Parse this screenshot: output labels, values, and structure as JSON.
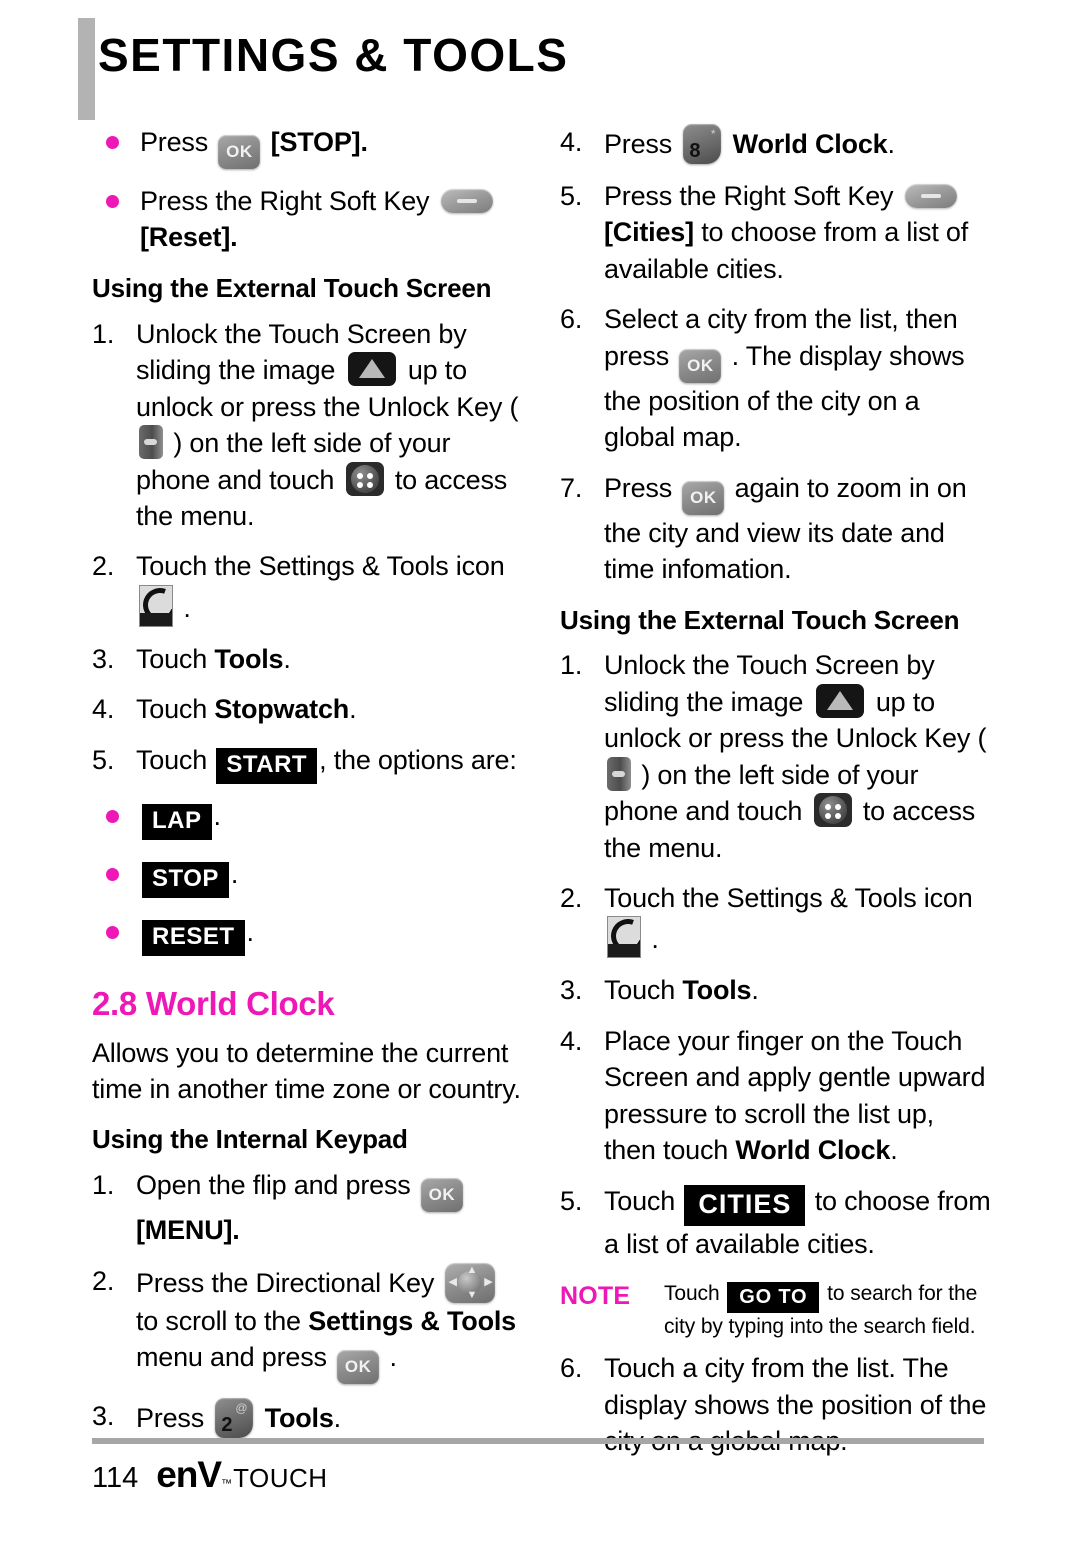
{
  "header": {
    "title": "SETTINGS & TOOLS"
  },
  "icons": {
    "ok_key": "OK",
    "num2_digit": "2",
    "num2_sup": "@",
    "num8_digit": "8",
    "num8_sup": "*"
  },
  "left_column": {
    "bullets_top": [
      {
        "pre": "Press ",
        "key": "ok-key",
        "post": " [STOP]."
      },
      {
        "pre": "Press the Right Soft Key ",
        "key": "right-soft-key",
        "post": " [Reset]."
      }
    ],
    "bullet1_text_pre": "Press",
    "bullet1_text_post": "[STOP].",
    "bullet2_text_pre": "Press the Right Soft Key",
    "bullet2_text_post": "[Reset].",
    "heading_external": "Using the External Touch Screen",
    "step1_a": "Unlock the Touch Screen by sliding the image",
    "step1_b": "up to unlock or press the Unlock Key (",
    "step1_c": ") on the left side of your phone and touch",
    "step1_d": "to access the menu.",
    "step2_a": "Touch the Settings & Tools icon",
    "step2_b": ".",
    "step3_a": "Touch ",
    "step3_b": "Tools",
    "step3_c": ".",
    "step4_a": "Touch ",
    "step4_b": "Stopwatch",
    "step4_c": ".",
    "step5_a": "Touch",
    "step5_btn": "START",
    "step5_b": ", the options are:",
    "options": [
      "LAP",
      "STOP",
      "RESET"
    ],
    "option_suffix": ".",
    "chapter_heading": "2.8 World Clock",
    "chapter_intro": "Allows you to determine the current time in another time zone or country.",
    "heading_internal": "Using the Internal Keypad",
    "k_step1_a": "Open the flip and press",
    "k_step1_b": "[MENU].",
    "k_step2_a": "Press the Directional Key",
    "k_step2_b": "to scroll to the ",
    "k_step2_bold": "Settings & Tools",
    "k_step2_c": " menu and press",
    "k_step2_d": ".",
    "k_step3_a": "Press",
    "k_step3_bold": "Tools",
    "k_step3_b": "."
  },
  "right_column": {
    "step4_a": "Press",
    "step4_bold": "World Clock",
    "step4_b": ".",
    "step5_a": "Press the Right Soft Key",
    "step5_bold": "[Cities]",
    "step5_b": " to choose from a list of available cities.",
    "step6_a": "Select a city from the list, then press",
    "step6_b": ". The display shows the position of the city on a global map.",
    "step7_a": "Press",
    "step7_b": "again to zoom in on the city and view its date and time infomation.",
    "heading_external": "Using the External Touch Screen",
    "e_step1_a": "Unlock the Touch Screen by sliding the image",
    "e_step1_b": "up to unlock or press the Unlock Key (",
    "e_step1_c": ") on the left side of your phone and touch",
    "e_step1_d": "to access the menu.",
    "e_step2_a": "Touch the Settings & Tools icon",
    "e_step2_b": ".",
    "e_step3_a": "Touch ",
    "e_step3_bold": "Tools",
    "e_step3_b": ".",
    "e_step4_a": "Place your finger on the Touch Screen and apply gentle upward pressure to scroll the list up, then touch ",
    "e_step4_bold": "World Clock",
    "e_step4_b": ".",
    "e_step5_a": "Touch",
    "e_step5_btn": "CITIES",
    "e_step5_b": "to choose from a list of available cities.",
    "note_label": "NOTE",
    "note_a": "Touch",
    "note_btn": "GO TO",
    "note_b": "to search for the city by typing into the search field.",
    "e_step6": "Touch a city from the list. The display shows the position of the city on a global map."
  },
  "numbers": {
    "n1": "1.",
    "n2": "2.",
    "n3": "3.",
    "n4": "4.",
    "n5": "5.",
    "n6": "6.",
    "n7": "7."
  },
  "footer": {
    "page_number": "114",
    "logo_env": "enV",
    "logo_tm": "™",
    "logo_touch": "TOUCH"
  },
  "colors": {
    "accent_magenta": "#ee18b6",
    "rule_gray": "#a6a6a6",
    "header_bar_gray": "#b3b3b3"
  }
}
